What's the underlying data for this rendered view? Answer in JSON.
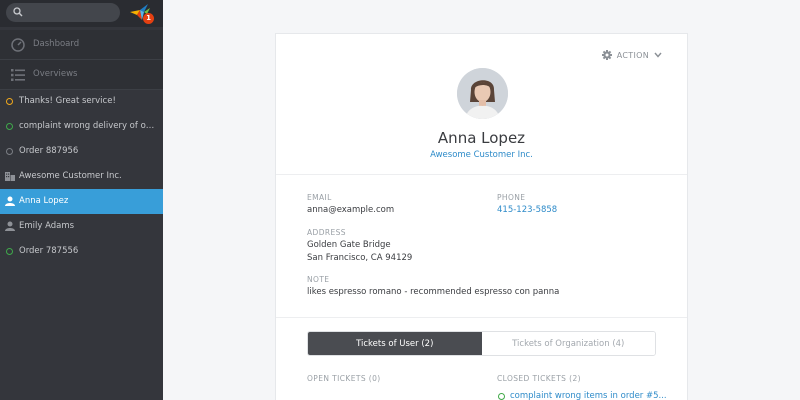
{
  "sidebar": {
    "search": {
      "placeholder": ""
    },
    "notification_count": "1",
    "nav": [
      {
        "label": "Dashboard",
        "icon": "dashboard-icon"
      },
      {
        "label": "Overviews",
        "icon": "list-icon"
      }
    ],
    "tasks": [
      {
        "label": "Thanks! Great service!",
        "icon": "ticket-status-dot",
        "color": "#f0a81c"
      },
      {
        "label": "complaint wrong delivery of order #",
        "icon": "ticket-status-dot",
        "color": "#3fa94b"
      },
      {
        "label": "Order 887956",
        "icon": "ticket-status-dot",
        "color": "#7b7e84"
      },
      {
        "label": "Awesome Customer Inc.",
        "icon": "organization-icon"
      },
      {
        "label": "Anna Lopez",
        "icon": "user-icon",
        "active": true
      },
      {
        "label": "Emily Adams",
        "icon": "user-icon"
      },
      {
        "label": "Order 787556",
        "icon": "ticket-status-dot",
        "color": "#3fa94b"
      }
    ]
  },
  "profile": {
    "action_label": "ACTION",
    "name": "Anna Lopez",
    "organization": "Awesome Customer Inc.",
    "fields": {
      "email_label": "EMAIL",
      "email": "anna@example.com",
      "phone_label": "PHONE",
      "phone": "415-123-5858",
      "address_label": "ADDRESS",
      "address_line1": "Golden Gate Bridge",
      "address_line2": "San Francisco, CA 94129",
      "note_label": "NOTE",
      "note": "likes espresso romano - recommended espresso con panna"
    },
    "tabs": [
      {
        "label": "Tickets of User (2)",
        "selected": true
      },
      {
        "label": "Tickets of Organization (4)",
        "selected": false
      }
    ],
    "open_tickets_label": "OPEN TICKETS (0)",
    "closed_tickets_label": "CLOSED TICKETS (2)",
    "closed_tickets": [
      {
        "label": "complaint wrong items in order #5..."
      }
    ]
  },
  "colors": {
    "accent": "#389ed9",
    "link": "#2e8bc9",
    "sidebar_bg": "#34363c"
  }
}
